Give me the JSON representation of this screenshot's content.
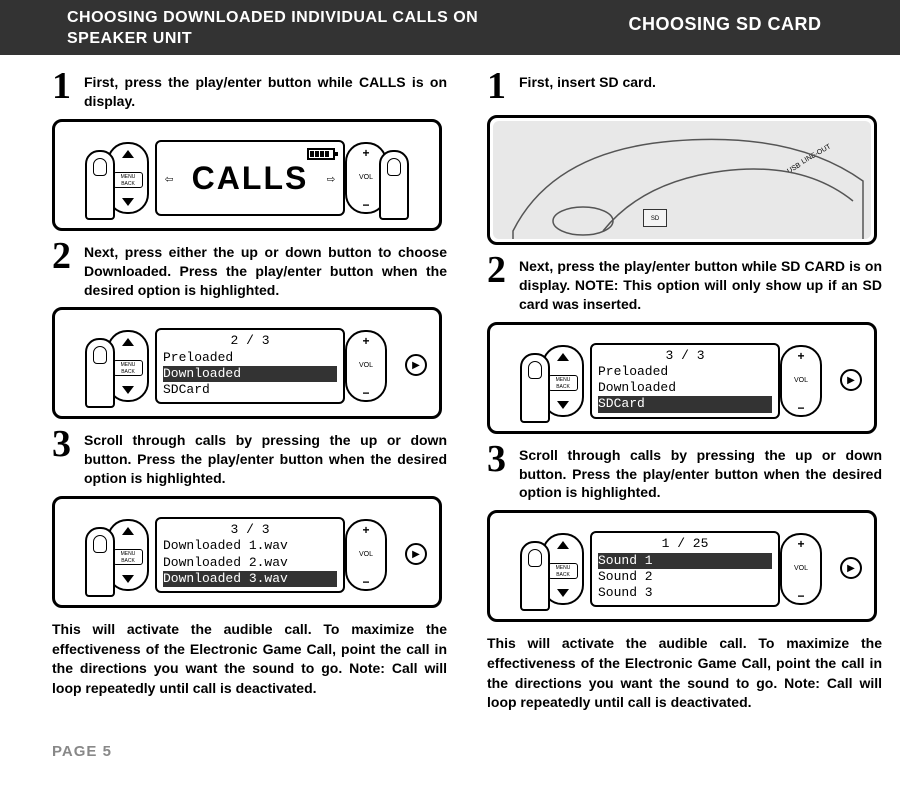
{
  "header": {
    "left": "CHOOSING DOWNLOADED INDIVIDUAL CALLS ON SPEAKER UNIT",
    "right": "CHOOSING SD CARD"
  },
  "left": {
    "step1": {
      "num": "1",
      "text": "First, press the play/enter button while CALLS is on display."
    },
    "step2": {
      "num": "2",
      "text": "Next, press either the up or down button to choose Downloaded. Press the play/enter button when the desired option is highlighted."
    },
    "step3": {
      "num": "3",
      "text": "Scroll through calls by pressing the up or down button. Press the play/enter button when the desired option is highlighted."
    },
    "closing_a": "This will activate the audible call. To maximize the effectiveness of the Electronic Game Call, point the call in the directions you want the sound to go. ",
    "closing_b": "Note: Call will loop repeatedly until call is deactivated.",
    "fig1_calls": "CALLS",
    "fig2": {
      "counter": "2 / 3",
      "r1": "Preloaded",
      "r2": "Downloaded",
      "r3": "SDCard"
    },
    "fig3": {
      "counter": "3 / 3",
      "r1": "Downloaded 1.wav",
      "r2": "Downloaded 2.wav",
      "r3": "Downloaded 3.wav"
    }
  },
  "right": {
    "step1": {
      "num": "1",
      "text": "First, insert SD card."
    },
    "step2": {
      "num": "2",
      "text_a": "Next, press the play/enter button while SD CARD is on display. ",
      "text_b": "NOTE: This option will only show up if an SD card was inserted."
    },
    "step3": {
      "num": "3",
      "text": "Scroll through calls by pressing the up or down button. Press the play/enter button when the desired option is highlighted."
    },
    "closing_a": "This will activate the audible call. To maximize the effectiveness of the Electronic Game Call, point the call in the directions you want the sound to go. ",
    "closing_b": "Note: Call will loop repeatedly until call is deactivated.",
    "fig2": {
      "counter": "3 / 3",
      "r1": "Preloaded",
      "r2": "Downloaded",
      "r3": "SDCard"
    },
    "fig3": {
      "counter": "1 / 25",
      "r1": "Sound 1",
      "r2": "Sound 2",
      "r3": "Sound 3"
    },
    "sd_labels": {
      "usb": "USB",
      "lineout": "LINE-OUT",
      "sd": "SD"
    }
  },
  "knob": {
    "menuback": "MENU\nBACK",
    "vol": "VOL",
    "plus": "+",
    "minus": "−",
    "play": "▶"
  },
  "footer": "PAGE 5"
}
